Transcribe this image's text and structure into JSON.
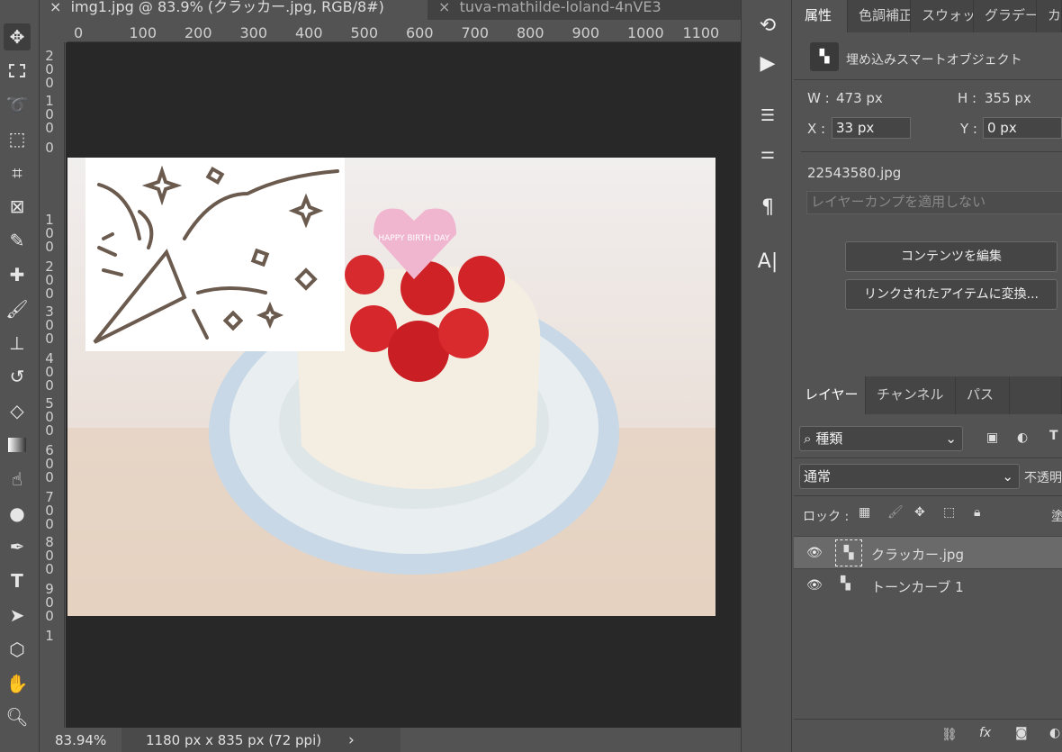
{
  "document_tabs": [
    {
      "label": "img1.jpg @ 83.9% (クラッカー.jpg, RGB/8#)",
      "close": "×",
      "active": true
    },
    {
      "label": "tuva-mathilde-loland-4nVE3",
      "close": "×",
      "active": false
    }
  ],
  "ruler": {
    "h_ticks": [
      "0",
      "100",
      "200",
      "300",
      "400",
      "500",
      "600",
      "700",
      "800",
      "900",
      "1000",
      "1100"
    ],
    "v_ticks": [
      "200",
      "100",
      "0",
      "100",
      "200",
      "300",
      "400",
      "500",
      "600",
      "700",
      "800",
      "900",
      "1"
    ]
  },
  "tools": [
    "move",
    "marquee",
    "lasso",
    "object-select",
    "crop",
    "frame",
    "eyedropper",
    "healing",
    "brush",
    "stamp",
    "history-brush",
    "eraser",
    "gradient",
    "smudge",
    "dodge",
    "pen",
    "type",
    "path-select",
    "shape",
    "hand",
    "zoom"
  ],
  "canvas": {
    "sticker_text": "HAPPY BIRTH DAY"
  },
  "status": {
    "zoom": "83.94%",
    "doc_info": "1180 px x 835 px (72 ppi)",
    "arrow": "›"
  },
  "properties": {
    "tabs": [
      "属性",
      "色調補正",
      "スウォッチ",
      "グラデー",
      "カ"
    ],
    "object_type": "埋め込みスマートオブジェクト",
    "w_label": "W :",
    "w_value": "473 px",
    "h_label": "H :",
    "h_value": "355 px",
    "x_label": "X :",
    "x_value": "33 px",
    "y_label": "Y :",
    "y_value": "0 px",
    "filename": "22543580.jpg",
    "layer_comp_placeholder": "レイヤーカンプを適用しない",
    "edit_contents": "コンテンツを編集",
    "convert_linked": "リンクされたアイテムに変換..."
  },
  "layers": {
    "tabs": [
      "レイヤー",
      "チャンネル",
      "パス"
    ],
    "filter": "種類",
    "blend_mode": "通常",
    "opacity_label": "不透明",
    "lock_label": "ロック :",
    "fill_label": "塗",
    "items": [
      {
        "name": "クラッカー.jpg",
        "visible": true,
        "selected": true
      },
      {
        "name": "トーンカーブ 1",
        "visible": true,
        "selected": false
      }
    ],
    "footer_fx": "fx"
  }
}
